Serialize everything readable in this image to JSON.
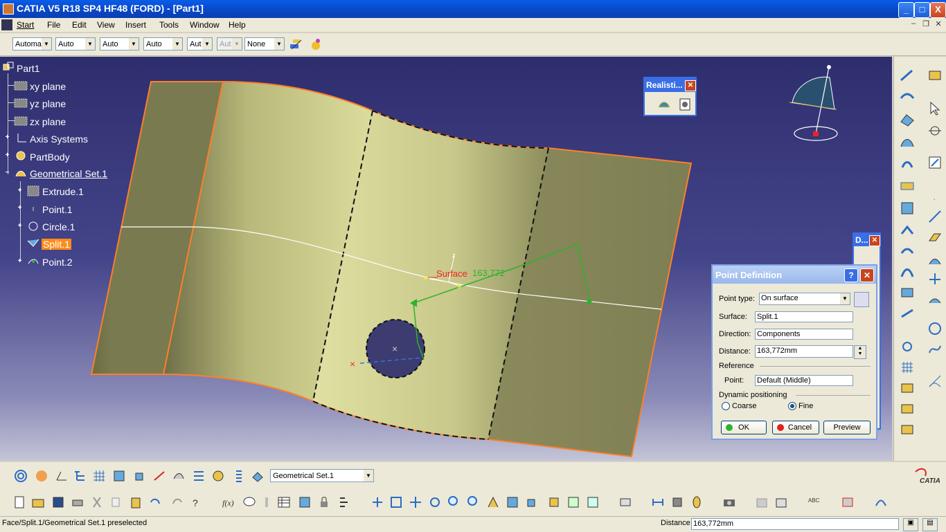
{
  "window": {
    "title": "CATIA V5 R18 SP4 HF48 (FORD) - [Part1]",
    "buttons": [
      "_",
      "□",
      "X"
    ]
  },
  "menu": {
    "items": [
      "Start",
      "File",
      "Edit",
      "View",
      "Insert",
      "Tools",
      "Window",
      "Help"
    ]
  },
  "properties_toolbar": {
    "combos": [
      "Automa",
      "Auto",
      "Auto",
      "Auto",
      "Aut",
      "Aut",
      "None"
    ]
  },
  "tree": {
    "root": "Part1",
    "items": [
      {
        "label": "xy plane"
      },
      {
        "label": "yz plane"
      },
      {
        "label": "zx plane"
      },
      {
        "label": "Axis Systems"
      },
      {
        "label": "PartBody"
      },
      {
        "label": "Geometrical Set.1"
      },
      {
        "label": "Extrude.1"
      },
      {
        "label": "Point.1"
      },
      {
        "label": "Circle.1"
      },
      {
        "label": "Split.1"
      },
      {
        "label": "Point.2"
      }
    ]
  },
  "viewport": {
    "annotation_surface": "Surface",
    "annotation_distance": "163,772"
  },
  "realistic_toolbar": {
    "title": "Realisti..."
  },
  "d_toolbar": {
    "title": "D..."
  },
  "dialog": {
    "title": "Point Definition",
    "point_type_label": "Point type:",
    "point_type_value": "On surface",
    "surface_label": "Surface:",
    "surface_value": "Split.1",
    "direction_label": "Direction:",
    "direction_value": "Components",
    "distance_label": "Distance:",
    "distance_value": "163,772mm",
    "reference_label": "Reference",
    "point_label": "Point:",
    "point_value": "Default (Middle)",
    "dynamic_label": "Dynamic positioning",
    "coarse_label": "Coarse",
    "fine_label": "Fine",
    "ok_label": "OK",
    "cancel_label": "Cancel",
    "preview_label": "Preview"
  },
  "bottom_toolbar": {
    "current_set": "Geometrical Set.1"
  },
  "status": {
    "message": "Face/Split.1/Geometrical Set.1 preselected",
    "distance_label": "Distance",
    "distance_value": "163,772mm"
  },
  "brand": "CATIA",
  "colors": {
    "surface": "#c9c98a",
    "edge": "#ff7f27",
    "selection": "#ff8c1a",
    "dialog_header": "#9ab8ec"
  }
}
